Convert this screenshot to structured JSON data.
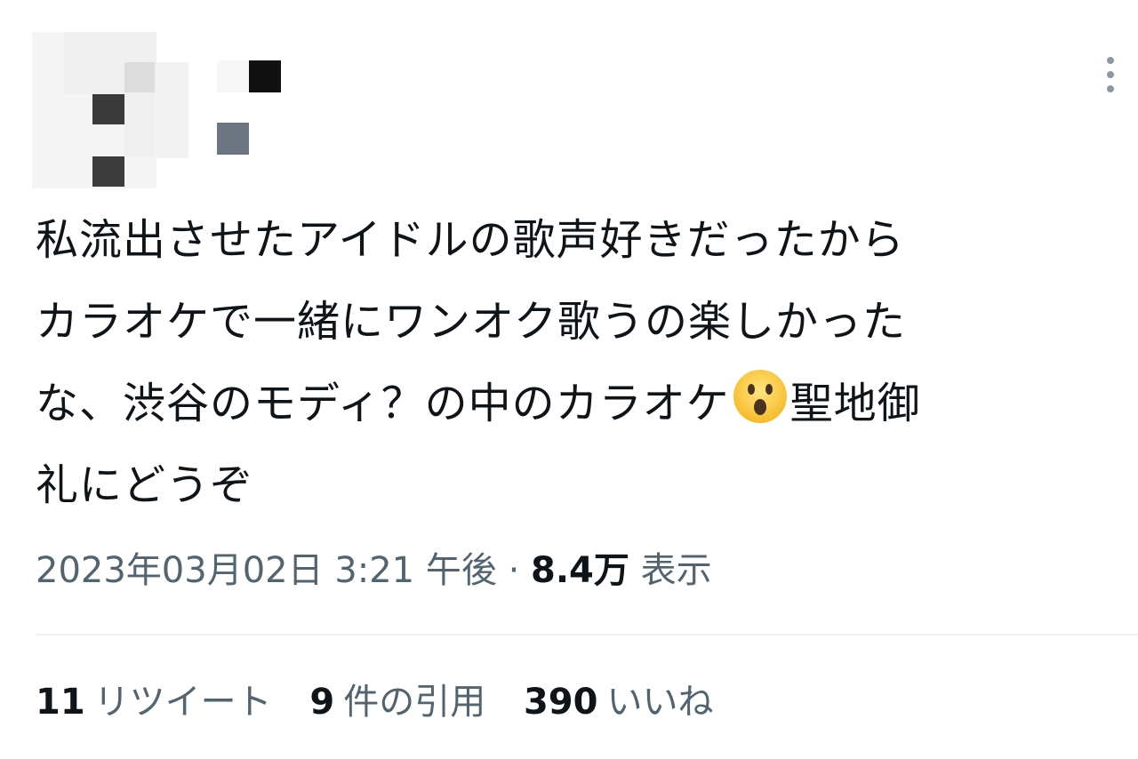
{
  "tweet": {
    "lines": [
      "私流出させたアイドルの歌声好きだったから",
      "カラオケで一緒にワンオク歌うの楽しかった",
      "な、渋谷のモディ？の中のカラオケ",
      "礼にどうぞ"
    ],
    "line3_after_emoji": "聖地御",
    "emoji": "hushed-face-emoji"
  },
  "meta": {
    "timestamp": "2023年03月02日 3:21 午後",
    "separator": "·",
    "views_count": "8.4万",
    "views_label": "表示"
  },
  "stats": {
    "retweets_count": "11",
    "retweets_label": "リツイート",
    "quotes_count": "9",
    "quotes_label": "件の引用",
    "likes_count": "390",
    "likes_label": "いいね"
  },
  "icons": {
    "more": "more-vertical-icon",
    "avatar": "blurred-avatar"
  },
  "colors": {
    "text": "#0f1419",
    "secondary": "#536471",
    "divider": "#eff3f4",
    "more_icon": "#8b98a5"
  }
}
